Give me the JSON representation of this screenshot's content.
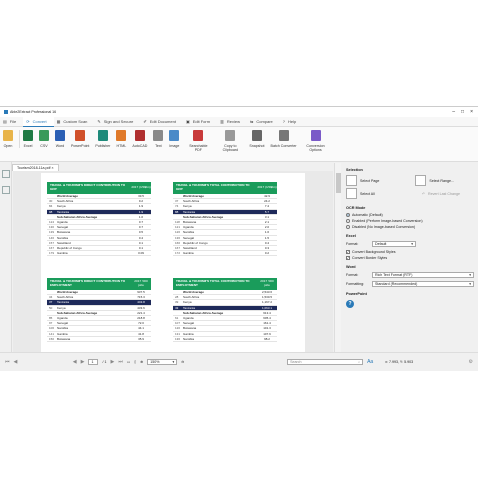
{
  "colors": {
    "accent": "#2a7ab8",
    "table_header": "#1a9c5b",
    "highlight_row": "#1e2a5a"
  },
  "window": {
    "title": "Able2Extract Professional 16",
    "controls": [
      "minimize-icon",
      "maximize-icon",
      "close-icon"
    ]
  },
  "menu": {
    "items": [
      {
        "label": "File",
        "icon": "file-icon"
      },
      {
        "label": "Convert",
        "icon": "convert-icon"
      },
      {
        "label": "Custom Scan",
        "icon": "scan-icon"
      },
      {
        "label": "Sign and Secure",
        "icon": "sign-icon"
      },
      {
        "label": "Edit Document",
        "icon": "edit-icon"
      },
      {
        "label": "Edit Form",
        "icon": "form-icon"
      },
      {
        "label": "Review",
        "icon": "review-icon"
      },
      {
        "label": "Compare",
        "icon": "compare-icon"
      },
      {
        "label": "Help",
        "icon": "help-icon"
      }
    ]
  },
  "ribbon": {
    "buttons": [
      {
        "label": "Open",
        "icon": "folder-icon",
        "color": "#e8b44a"
      },
      {
        "label": "Excel",
        "icon": "excel-icon",
        "color": "#1f7a44"
      },
      {
        "label": "CSV",
        "icon": "csv-icon",
        "color": "#3a9a5a"
      },
      {
        "label": "Word",
        "icon": "word-icon",
        "color": "#2b5fb4"
      },
      {
        "label": "PowerPoint",
        "icon": "powerpoint-icon",
        "color": "#d0502a"
      },
      {
        "label": "Publisher",
        "icon": "publisher-icon",
        "color": "#1e8a7a"
      },
      {
        "label": "HTML",
        "icon": "html-icon",
        "color": "#e07a2a"
      },
      {
        "label": "AutoCAD",
        "icon": "autocad-icon",
        "color": "#b03030"
      },
      {
        "label": "Text",
        "icon": "text-icon",
        "color": "#8a8a8a"
      },
      {
        "label": "Image",
        "icon": "image-icon",
        "color": "#4a8ac8"
      },
      {
        "label": "Searchable PDF",
        "icon": "searchable-pdf-icon",
        "color": "#c83a3a"
      },
      {
        "label": "Copy to Clipboard",
        "icon": "clipboard-icon",
        "color": "#999999"
      },
      {
        "label": "Snapshot",
        "icon": "snapshot-icon",
        "color": "#666666"
      },
      {
        "label": "Batch Converter",
        "icon": "batch-icon",
        "color": "#777777"
      },
      {
        "label": "Conversion Options",
        "icon": "conversion-options-icon",
        "color": "#7a5ac8"
      }
    ]
  },
  "document_tab": {
    "label": "Tourism2018-11a.pdf ×"
  },
  "tables": [
    {
      "title": "TRAVEL & TOURISM'S DIRECT CONTRIBUTION TO GDP",
      "unit": "2017 (US$bn)",
      "rows": [
        {
          "rank": "",
          "country": "World Average",
          "value": "33.5",
          "type": "avg"
        },
        {
          "rank": "30",
          "country": "South Africa",
          "value": "9.2",
          "type": ""
        },
        {
          "rank": "84",
          "country": "Kenya",
          "value": "1.9",
          "type": ""
        },
        {
          "rank": "98",
          "country": "Tanzania",
          "value": "1.9",
          "type": "hl"
        },
        {
          "rank": "",
          "country": "Sub-Saharan Africa Average",
          "value": "1.0",
          "type": "avg"
        },
        {
          "rank": "124",
          "country": "Uganda",
          "value": "0.7",
          "type": ""
        },
        {
          "rank": "130",
          "country": "Senegal",
          "value": "0.7",
          "type": ""
        },
        {
          "rank": "139",
          "country": "Botswana",
          "value": "0.5",
          "type": ""
        },
        {
          "rank": "146",
          "country": "Namibia",
          "value": "0.4",
          "type": ""
        },
        {
          "rank": "157",
          "country": "Swaziland",
          "value": "0.1",
          "type": ""
        },
        {
          "rank": "167",
          "country": "Republic of Congo",
          "value": "0.1",
          "type": ""
        },
        {
          "rank": "179",
          "country": "Gambia",
          "value": "0.09",
          "type": ""
        }
      ]
    },
    {
      "title": "TRAVEL & TOURISM'S TOTAL CONTRIBUTION TO GDP",
      "unit": "2017 (US$bn)",
      "rows": [
        {
          "rank": "",
          "country": "World Average",
          "value": "42.9",
          "type": "avg"
        },
        {
          "rank": "37",
          "country": "South Africa",
          "value": "24.2",
          "type": ""
        },
        {
          "rank": "74",
          "country": "Kenya",
          "value": "7.4",
          "type": ""
        },
        {
          "rank": "88",
          "country": "Tanzania",
          "value": "5.7",
          "type": "hl"
        },
        {
          "rank": "",
          "country": "Sub-Saharan Africa Average",
          "value": "3.1",
          "type": "avg"
        },
        {
          "rank": "118",
          "country": "Botswana",
          "value": "2.1",
          "type": ""
        },
        {
          "rank": "121",
          "country": "Uganda",
          "value": "2.0",
          "type": ""
        },
        {
          "rank": "126",
          "country": "Namibia",
          "value": "1.6",
          "type": ""
        },
        {
          "rank": "136",
          "country": "Senegal",
          "value": "1.5",
          "type": ""
        },
        {
          "rank": "166",
          "country": "Republic of Congo",
          "value": "0.4",
          "type": ""
        },
        {
          "rank": "167",
          "country": "Swaziland",
          "value": "0.3",
          "type": ""
        },
        {
          "rank": "172",
          "country": "Gambia",
          "value": "0.2",
          "type": ""
        }
      ]
    },
    {
      "title": "TRAVEL & TOURISM'S DIRECT CONTRIBUTION TO EMPLOYMENT",
      "unit": "2017 '000 jobs",
      "rows": [
        {
          "rank": "",
          "country": "World Average",
          "value": "937.5",
          "type": "avg"
        },
        {
          "rank": "34",
          "country": "South Africa",
          "value": "715.3",
          "type": ""
        },
        {
          "rank": "37",
          "country": "Tanzania",
          "value": "443.8",
          "type": "hl"
        },
        {
          "rank": "50",
          "country": "Kenya",
          "value": "433.6",
          "type": ""
        },
        {
          "rank": "",
          "country": "Sub-Saharan Africa Average",
          "value": "221.4",
          "type": "avg"
        },
        {
          "rank": "85",
          "country": "Uganda",
          "value": "218.8",
          "type": ""
        },
        {
          "rank": "97",
          "country": "Senegal",
          "value": "72.0",
          "type": ""
        },
        {
          "rank": "106",
          "country": "Namibia",
          "value": "44.1",
          "type": ""
        },
        {
          "rank": "141",
          "country": "Gambia",
          "value": "41.8",
          "type": ""
        },
        {
          "rank": "150",
          "country": "Botswana",
          "value": "35.9",
          "type": ""
        }
      ]
    },
    {
      "title": "TRAVEL & TOURISM'S TOTAL CONTRIBUTION TO EMPLOYMENT",
      "unit": "2017 '000 jobs",
      "rows": [
        {
          "rank": "",
          "country": "World Average",
          "value": "2,543.6",
          "type": "avg"
        },
        {
          "rank": "28",
          "country": "South Africa",
          "value": "1,530.5",
          "type": ""
        },
        {
          "rank": "39",
          "country": "Kenya",
          "value": "1,167.2",
          "type": ""
        },
        {
          "rank": "43",
          "country": "Tanzania",
          "value": "1,063.1",
          "type": "hl"
        },
        {
          "rank": "",
          "country": "Sub-Saharan Africa Average",
          "value": "613.4",
          "type": "avg"
        },
        {
          "rank": "61",
          "country": "Uganda",
          "value": "605.4",
          "type": ""
        },
        {
          "rank": "107",
          "country": "Senegal",
          "value": "161.4",
          "type": ""
        },
        {
          "rank": "120",
          "country": "Botswana",
          "value": "101.3",
          "type": ""
        },
        {
          "rank": "131",
          "country": "Gambia",
          "value": "107.9",
          "type": ""
        },
        {
          "rank": "136",
          "country": "Namibia",
          "value": "98.2",
          "type": ""
        }
      ]
    }
  ],
  "panel": {
    "selection": {
      "title": "Selection",
      "select_page": "Select Page",
      "select_range": "Select Range...",
      "select_all": "Select All",
      "revert_last_change": "Revert Last Change"
    },
    "ocr": {
      "title": "OCR Mode",
      "options": [
        {
          "label": "Automatic (Default)",
          "selected": true
        },
        {
          "label": "Enabled (Perform Image-based Conversion)",
          "selected": false
        },
        {
          "label": "Disabled (No Image-based Conversion)",
          "selected": false
        }
      ]
    },
    "excel": {
      "title": "Excel",
      "format_label": "Format:",
      "format_value": "Default",
      "convert_border_styles": "Convert Border Styles",
      "convert_background_styles": "Convert Background Styles"
    },
    "word": {
      "title": "Word",
      "format_label": "Format:",
      "format_value": "Rich Text Format (RTF)",
      "formatting_label": "Formatting:",
      "formatting_value": "Standard (Recommended)"
    },
    "powerpoint": {
      "title": "PowerPoint"
    }
  },
  "status": {
    "page_value": "1",
    "page_total": "/ 1",
    "zoom": "150%",
    "search_placeholder": "Search",
    "aa_label": "Aa",
    "coords": "x: 7.993, Y: 5.903"
  }
}
